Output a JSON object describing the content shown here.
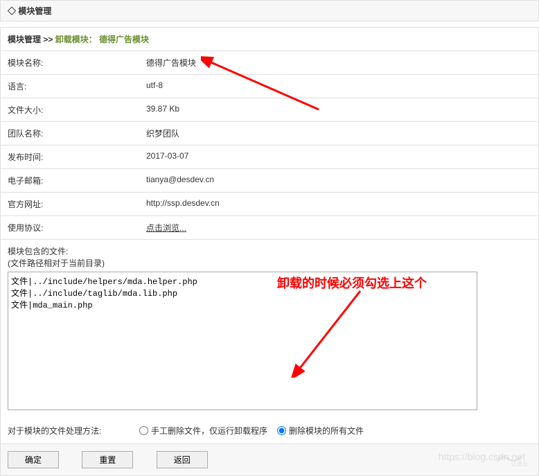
{
  "header": {
    "title": "模块管理"
  },
  "breadcrumb": {
    "root": "模块管理",
    "sep": " >> ",
    "current": "卸载模块： 德得广告模块"
  },
  "info": {
    "module_name_label": "模块名称:",
    "module_name": "德得广告模块",
    "language_label": "语言:",
    "language": "utf-8",
    "file_size_label": "文件大小:",
    "file_size": "39.87 Kb",
    "team_label": "团队名称:",
    "team": "织梦团队",
    "publish_label": "发布时间:",
    "publish": "2017-03-07",
    "email_label": "电子邮箱:",
    "email": "tianya@desdev.cn",
    "url_label": "官方网址:",
    "url": "http://ssp.desdev.cn",
    "license_label": "使用协议:",
    "license": "点击浏览..."
  },
  "files": {
    "label_line1": "模块包含的文件:",
    "label_line2": "(文件路径相对于当前目录)",
    "content": "文件|../include/helpers/mda.helper.php\n文件|../include/taglib/mda.lib.php\n文件|mda_main.php"
  },
  "radio": {
    "label": "对于模块的文件处理方法:",
    "option1": "手工删除文件，仅运行卸载程序",
    "option2": "删除模块的所有文件"
  },
  "buttons": {
    "ok": "确定",
    "reset": "重置",
    "back": "返回"
  },
  "annotation": {
    "text1": "卸载的时候必须勾选上这个"
  },
  "watermark": "https://blog.csdn.net",
  "logo_text": "亿速云"
}
